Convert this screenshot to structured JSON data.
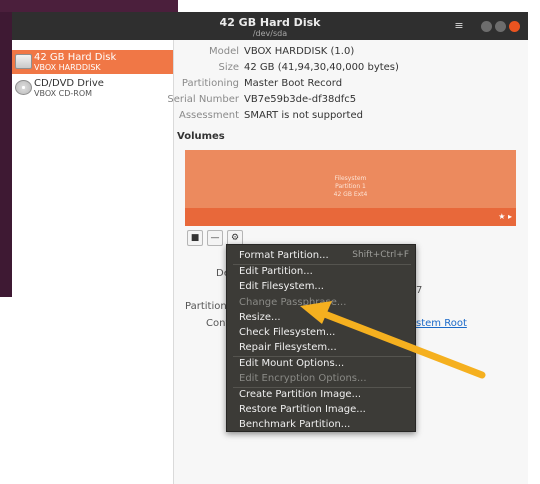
{
  "window": {
    "title": "42 GB Hard Disk",
    "subtitle": "/dev/sda",
    "menu_icon": "hamburger-icon",
    "controls": [
      "minimize-icon",
      "maximize-icon",
      "close-icon"
    ]
  },
  "sidebar": {
    "items": [
      {
        "name": "42 GB Hard Disk",
        "sub": "VBOX HARDDISK",
        "icon": "harddisk-icon",
        "selected": true
      },
      {
        "name": "CD/DVD Drive",
        "sub": "VBOX CD-ROM",
        "icon": "cdrom-icon",
        "selected": false
      }
    ]
  },
  "details": {
    "model_label": "Model",
    "model_value": "VBOX HARDDISK (1.0)",
    "size_label": "Size",
    "size_value": "42 GB (41,94,30,40,000 bytes)",
    "partitioning_label": "Partitioning",
    "partitioning_value": "Master Boot Record",
    "serial_label": "Serial Number",
    "serial_value": "VB7e59b3de-df38dfc5",
    "assessment_label": "Assessment",
    "assessment_value": "SMART is not supported"
  },
  "volumes": {
    "title": "Volumes",
    "partition_line1": "Filesystem",
    "partition_line2": "Partition 1",
    "partition_line3": "42 GB Ext4",
    "strip_icons": "★ ▸",
    "tools": [
      "stop-icon",
      "minus-icon",
      "gear-icon"
    ],
    "tool_glyphs": [
      "■",
      "—",
      "⚙"
    ]
  },
  "partial_labels": {
    "de": "De",
    "partition": "Partition",
    "conte": "Conte",
    "size_frag": "7",
    "link_frag": "stem Root"
  },
  "popup_menu": {
    "items": [
      {
        "label": "Format Partition...",
        "shortcut": "Shift+Ctrl+F",
        "enabled": true
      },
      {
        "label": "Edit Partition...",
        "enabled": true
      },
      {
        "label": "Edit Filesystem...",
        "enabled": true
      },
      {
        "label": "Change Passphrase...",
        "enabled": false
      },
      {
        "label": "Resize...",
        "enabled": true
      },
      {
        "label": "Check Filesystem...",
        "enabled": true
      },
      {
        "label": "Repair Filesystem...",
        "enabled": true
      },
      {
        "label": "Edit Mount Options...",
        "enabled": true
      },
      {
        "label": "Edit Encryption Options...",
        "enabled": false
      },
      {
        "label": "Create Partition Image...",
        "enabled": true
      },
      {
        "label": "Restore Partition Image...",
        "enabled": true
      },
      {
        "label": "Benchmark Partition...",
        "enabled": true
      }
    ]
  },
  "annotation": {
    "arrow_color": "#f5b01f",
    "points_to": "Resize..."
  },
  "colors": {
    "accent": "#f07746",
    "partition": "#ec8a5e",
    "titlebar": "#2f2f2f",
    "menu_bg": "#3c3b37"
  }
}
